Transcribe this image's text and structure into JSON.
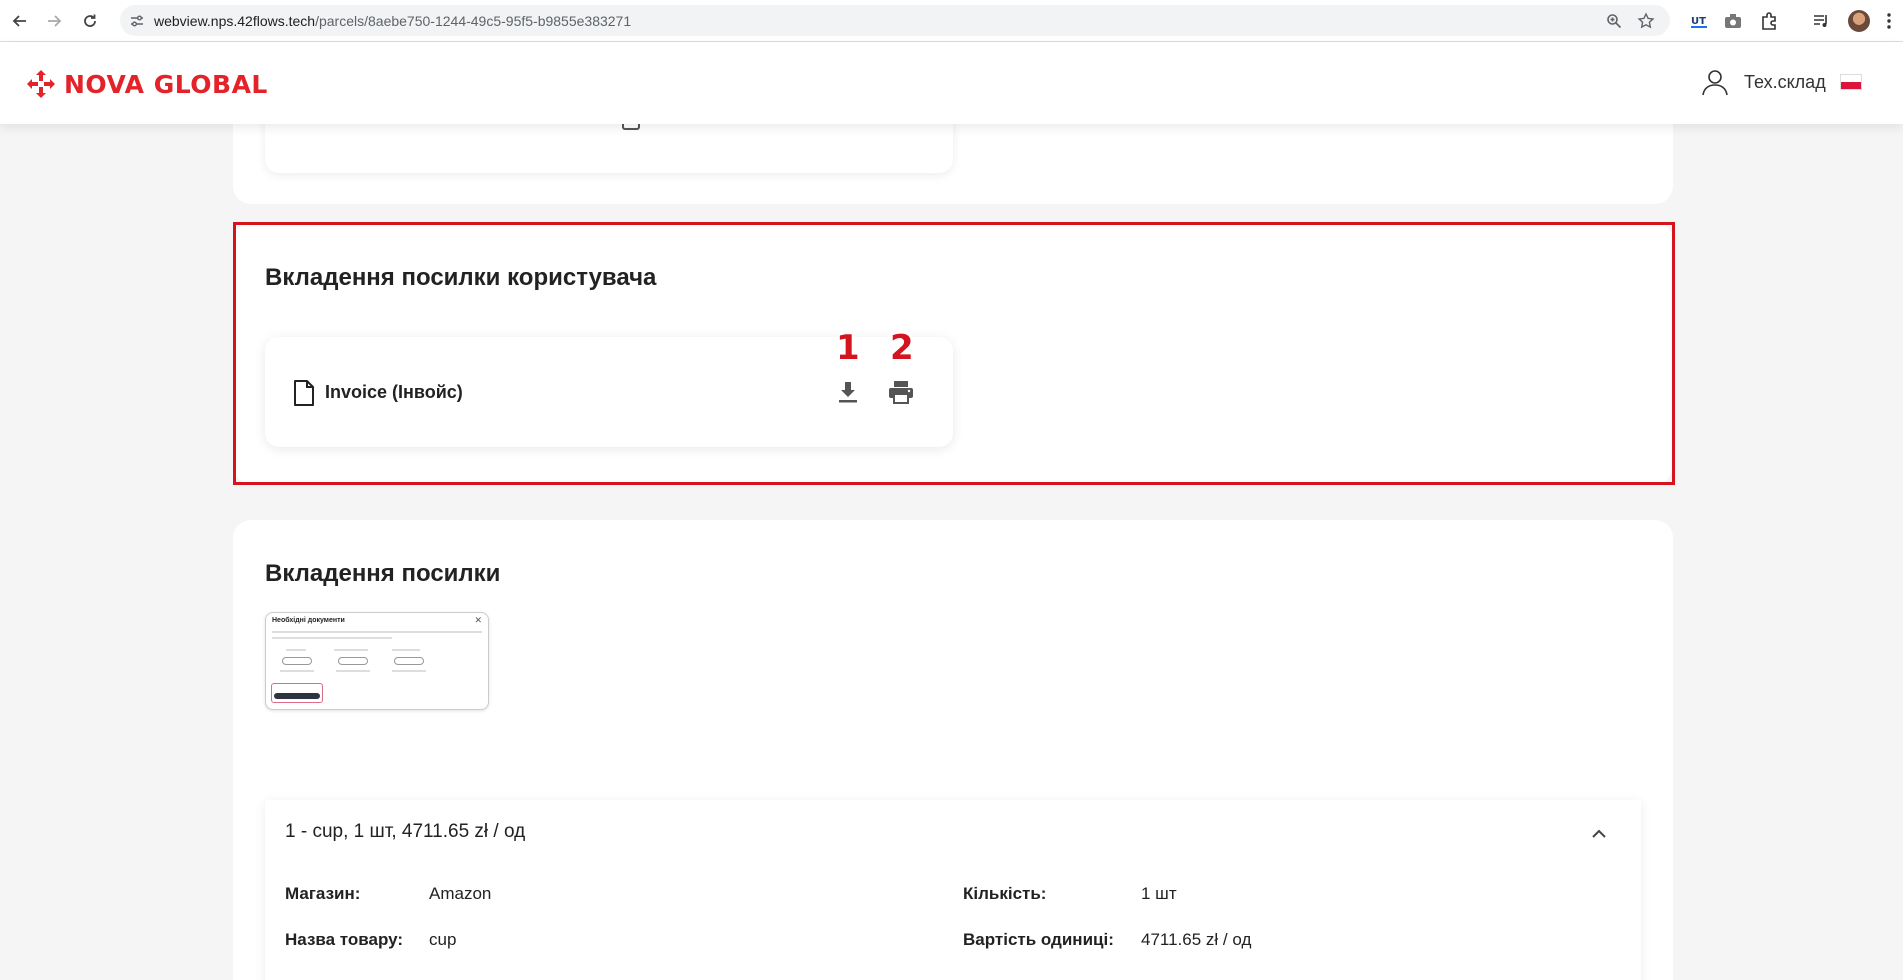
{
  "browser": {
    "url_host": "webview.nps.42flows.tech",
    "url_path": "/parcels/8aebe750-1244-49c5-95f5-b9855e383271"
  },
  "header": {
    "brand": "NOVA GLOBAL",
    "user_name": "Тех.склад",
    "brand_color": "#e3222a"
  },
  "user_attachments": {
    "title": "Вкладення посилки користувача",
    "files": [
      {
        "name": "Invoice (Інвойс)",
        "icon": "file-icon"
      }
    ],
    "markers": [
      "1",
      "2"
    ],
    "highlight_color": "#d4141f"
  },
  "parcel_attachments": {
    "title": "Вкладення посилки",
    "thumbnail_title": "Необхідні документи"
  },
  "item": {
    "summary": "1 - cup, 1 шт, 4711.65 zł / од",
    "fields": {
      "shop_label": "Магазин:",
      "shop_value": "Amazon",
      "product_label": "Назва товару:",
      "product_value": "cup",
      "quantity_label": "Кількість:",
      "quantity_value": "1 шт",
      "unit_price_label": "Вартість одиниці:",
      "unit_price_value": "4711.65 zł / од"
    }
  }
}
